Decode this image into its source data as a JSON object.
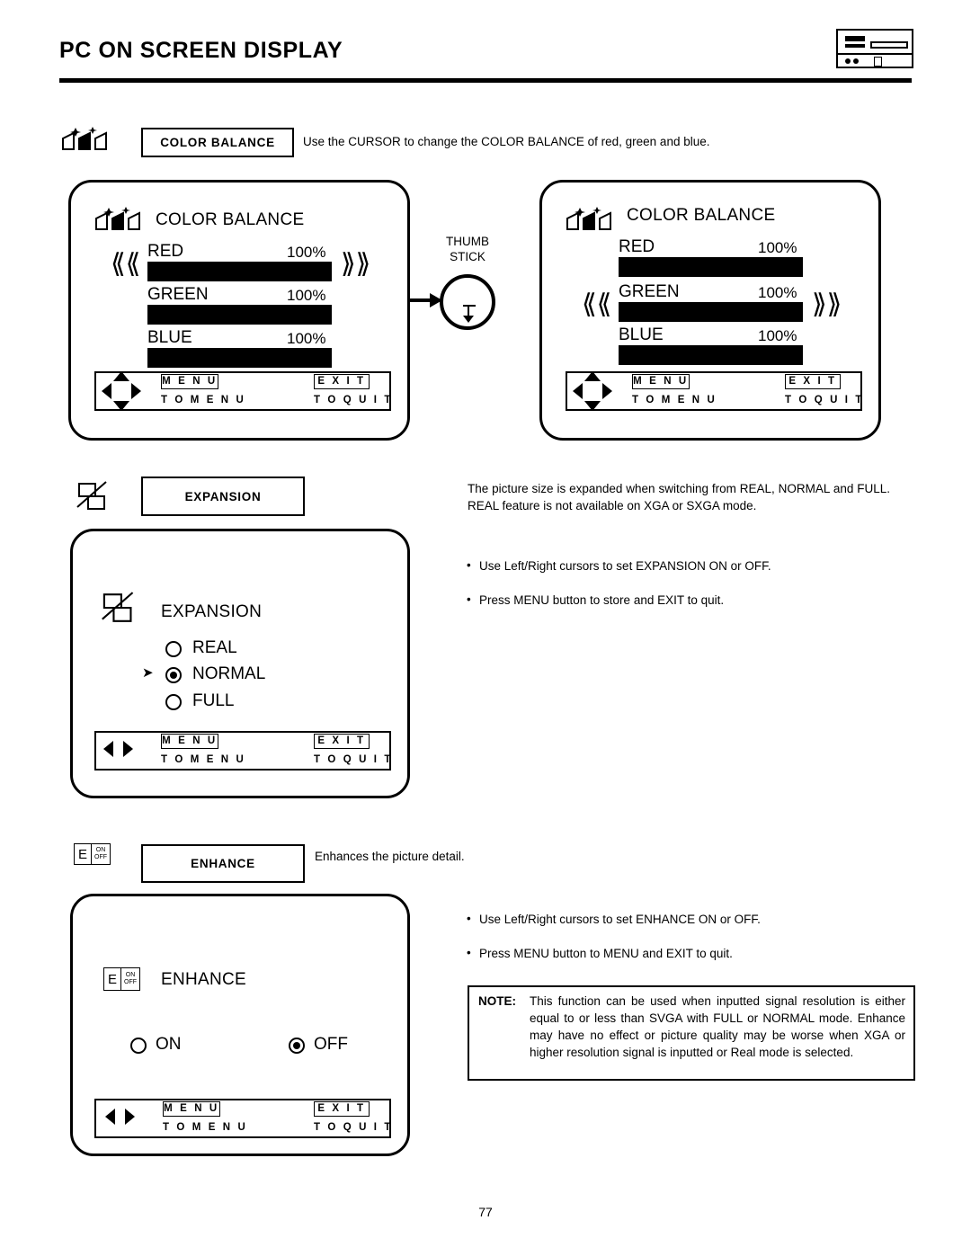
{
  "header": {
    "title": "PC ON SCREEN DISPLAY",
    "icon_name": "device-panel-icon"
  },
  "page_number": "77",
  "sections": [
    {
      "id": "color-balance",
      "label": "COLOR BALANCE",
      "icon": "color-balance-icon",
      "description": "Use the CURSOR to change the COLOR BALANCE of red, green and blue.",
      "osd_left": {
        "title": "COLOR BALANCE",
        "rows": [
          {
            "name": "RED",
            "value": "100%"
          },
          {
            "name": "GREEN",
            "value": "100%"
          },
          {
            "name": "BLUE",
            "value": "100%"
          }
        ],
        "selected_row": "RED",
        "hints": {
          "menu_key": "M E N U",
          "menu_text": "T O   M E N U",
          "exit_key": "E X I T",
          "exit_text": "T O   Q U I T"
        }
      },
      "osd_right": {
        "title": "COLOR BALANCE",
        "rows": [
          {
            "name": "RED",
            "value": "100%"
          },
          {
            "name": "GREEN",
            "value": "100%"
          },
          {
            "name": "BLUE",
            "value": "100%"
          }
        ],
        "selected_row": "GREEN",
        "hints": {
          "menu_key": "M E N U",
          "menu_text": "T O   M E N U",
          "exit_key": "E X I T",
          "exit_text": "T O   Q U I T"
        }
      },
      "thumbstick": {
        "line1": "THUMB",
        "line2": "STICK"
      }
    },
    {
      "id": "expansion",
      "label": "EXPANSION",
      "icon": "expansion-icon",
      "description": "The picture size is expanded when switching from REAL, NORMAL and FULL.  REAL feature is not available on XGA or SXGA mode.",
      "bullets": [
        "Use Left/Right cursors to set EXPANSION ON or OFF.",
        "Press MENU button to store and EXIT to quit."
      ],
      "osd": {
        "title": "EXPANSION",
        "options": [
          {
            "label": "REAL",
            "selected": false
          },
          {
            "label": "NORMAL",
            "selected": true
          },
          {
            "label": "FULL",
            "selected": false
          }
        ],
        "hints": {
          "menu_key": "M E N U",
          "menu_text": "T O   M E N U",
          "exit_key": "E X I T",
          "exit_text": "T O   Q U I T"
        }
      }
    },
    {
      "id": "enhance",
      "label": "ENHANCE",
      "icon": "enhance-icon",
      "icon_text": {
        "letter": "E",
        "on": "ON",
        "off": "OFF"
      },
      "description": "Enhances the picture detail.",
      "bullets": [
        "Use Left/Right cursors to set ENHANCE ON or OFF.",
        "Press MENU button to MENU and EXIT to quit."
      ],
      "osd": {
        "title": "ENHANCE",
        "options": [
          {
            "label": "ON",
            "selected": false
          },
          {
            "label": "OFF",
            "selected": true
          }
        ],
        "hints": {
          "menu_key": "M E N U",
          "menu_text": "T O   M E N U",
          "exit_key": "E X I T",
          "exit_text": "T O   Q U I T"
        }
      },
      "note": {
        "label": "NOTE:",
        "text": "This function can be used when inputted signal resolution is either equal to or less than SVGA with FULL or NORMAL mode.  Enhance may have no effect or picture quality may be worse when XGA or higher resolution signal is inputted or Real mode is selected."
      }
    }
  ]
}
